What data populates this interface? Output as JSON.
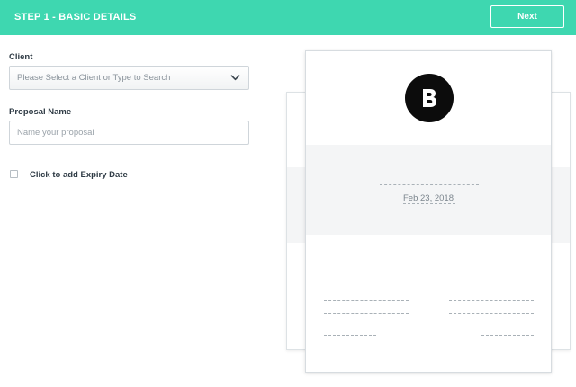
{
  "header": {
    "title": "STEP 1 - BASIC DETAILS",
    "next_label": "Next",
    "bg_color": "#3ed7b0"
  },
  "form": {
    "client": {
      "label": "Client",
      "placeholder": "Please Select a Client or Type to Search",
      "icon": "chevron-down-icon"
    },
    "proposal_name": {
      "label": "Proposal Name",
      "placeholder": "Name your proposal",
      "value": ""
    },
    "expiry": {
      "label": "Click to add Expiry Date",
      "checked": false
    }
  },
  "preview": {
    "logo_letter": "B",
    "date": "Feb 23, 2018"
  }
}
